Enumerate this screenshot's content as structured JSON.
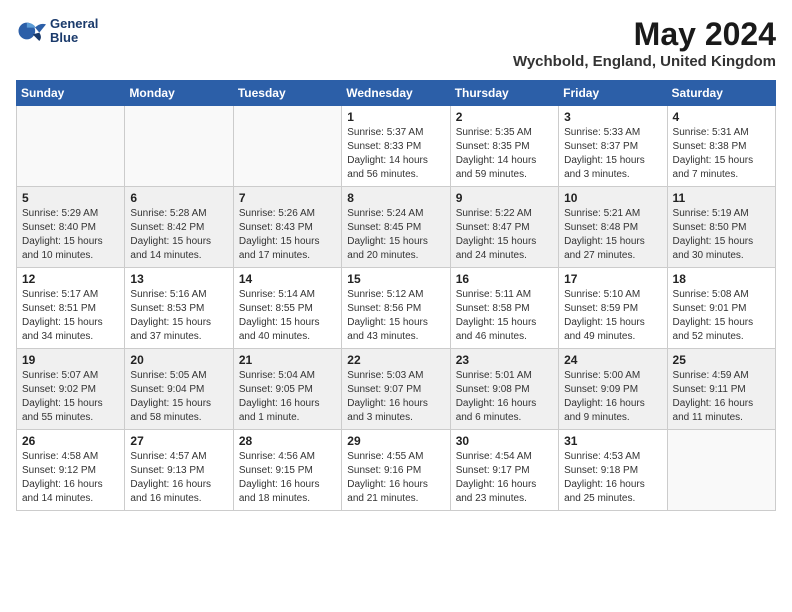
{
  "header": {
    "logo_line1": "General",
    "logo_line2": "Blue",
    "month_year": "May 2024",
    "location": "Wychbold, England, United Kingdom"
  },
  "weekdays": [
    "Sunday",
    "Monday",
    "Tuesday",
    "Wednesday",
    "Thursday",
    "Friday",
    "Saturday"
  ],
  "weeks": [
    [
      {
        "day": "",
        "info": ""
      },
      {
        "day": "",
        "info": ""
      },
      {
        "day": "",
        "info": ""
      },
      {
        "day": "1",
        "info": "Sunrise: 5:37 AM\nSunset: 8:33 PM\nDaylight: 14 hours\nand 56 minutes."
      },
      {
        "day": "2",
        "info": "Sunrise: 5:35 AM\nSunset: 8:35 PM\nDaylight: 14 hours\nand 59 minutes."
      },
      {
        "day": "3",
        "info": "Sunrise: 5:33 AM\nSunset: 8:37 PM\nDaylight: 15 hours\nand 3 minutes."
      },
      {
        "day": "4",
        "info": "Sunrise: 5:31 AM\nSunset: 8:38 PM\nDaylight: 15 hours\nand 7 minutes."
      }
    ],
    [
      {
        "day": "5",
        "info": "Sunrise: 5:29 AM\nSunset: 8:40 PM\nDaylight: 15 hours\nand 10 minutes."
      },
      {
        "day": "6",
        "info": "Sunrise: 5:28 AM\nSunset: 8:42 PM\nDaylight: 15 hours\nand 14 minutes."
      },
      {
        "day": "7",
        "info": "Sunrise: 5:26 AM\nSunset: 8:43 PM\nDaylight: 15 hours\nand 17 minutes."
      },
      {
        "day": "8",
        "info": "Sunrise: 5:24 AM\nSunset: 8:45 PM\nDaylight: 15 hours\nand 20 minutes."
      },
      {
        "day": "9",
        "info": "Sunrise: 5:22 AM\nSunset: 8:47 PM\nDaylight: 15 hours\nand 24 minutes."
      },
      {
        "day": "10",
        "info": "Sunrise: 5:21 AM\nSunset: 8:48 PM\nDaylight: 15 hours\nand 27 minutes."
      },
      {
        "day": "11",
        "info": "Sunrise: 5:19 AM\nSunset: 8:50 PM\nDaylight: 15 hours\nand 30 minutes."
      }
    ],
    [
      {
        "day": "12",
        "info": "Sunrise: 5:17 AM\nSunset: 8:51 PM\nDaylight: 15 hours\nand 34 minutes."
      },
      {
        "day": "13",
        "info": "Sunrise: 5:16 AM\nSunset: 8:53 PM\nDaylight: 15 hours\nand 37 minutes."
      },
      {
        "day": "14",
        "info": "Sunrise: 5:14 AM\nSunset: 8:55 PM\nDaylight: 15 hours\nand 40 minutes."
      },
      {
        "day": "15",
        "info": "Sunrise: 5:12 AM\nSunset: 8:56 PM\nDaylight: 15 hours\nand 43 minutes."
      },
      {
        "day": "16",
        "info": "Sunrise: 5:11 AM\nSunset: 8:58 PM\nDaylight: 15 hours\nand 46 minutes."
      },
      {
        "day": "17",
        "info": "Sunrise: 5:10 AM\nSunset: 8:59 PM\nDaylight: 15 hours\nand 49 minutes."
      },
      {
        "day": "18",
        "info": "Sunrise: 5:08 AM\nSunset: 9:01 PM\nDaylight: 15 hours\nand 52 minutes."
      }
    ],
    [
      {
        "day": "19",
        "info": "Sunrise: 5:07 AM\nSunset: 9:02 PM\nDaylight: 15 hours\nand 55 minutes."
      },
      {
        "day": "20",
        "info": "Sunrise: 5:05 AM\nSunset: 9:04 PM\nDaylight: 15 hours\nand 58 minutes."
      },
      {
        "day": "21",
        "info": "Sunrise: 5:04 AM\nSunset: 9:05 PM\nDaylight: 16 hours\nand 1 minute."
      },
      {
        "day": "22",
        "info": "Sunrise: 5:03 AM\nSunset: 9:07 PM\nDaylight: 16 hours\nand 3 minutes."
      },
      {
        "day": "23",
        "info": "Sunrise: 5:01 AM\nSunset: 9:08 PM\nDaylight: 16 hours\nand 6 minutes."
      },
      {
        "day": "24",
        "info": "Sunrise: 5:00 AM\nSunset: 9:09 PM\nDaylight: 16 hours\nand 9 minutes."
      },
      {
        "day": "25",
        "info": "Sunrise: 4:59 AM\nSunset: 9:11 PM\nDaylight: 16 hours\nand 11 minutes."
      }
    ],
    [
      {
        "day": "26",
        "info": "Sunrise: 4:58 AM\nSunset: 9:12 PM\nDaylight: 16 hours\nand 14 minutes."
      },
      {
        "day": "27",
        "info": "Sunrise: 4:57 AM\nSunset: 9:13 PM\nDaylight: 16 hours\nand 16 minutes."
      },
      {
        "day": "28",
        "info": "Sunrise: 4:56 AM\nSunset: 9:15 PM\nDaylight: 16 hours\nand 18 minutes."
      },
      {
        "day": "29",
        "info": "Sunrise: 4:55 AM\nSunset: 9:16 PM\nDaylight: 16 hours\nand 21 minutes."
      },
      {
        "day": "30",
        "info": "Sunrise: 4:54 AM\nSunset: 9:17 PM\nDaylight: 16 hours\nand 23 minutes."
      },
      {
        "day": "31",
        "info": "Sunrise: 4:53 AM\nSunset: 9:18 PM\nDaylight: 16 hours\nand 25 minutes."
      },
      {
        "day": "",
        "info": ""
      }
    ]
  ],
  "shaded_rows": [
    1,
    3
  ]
}
